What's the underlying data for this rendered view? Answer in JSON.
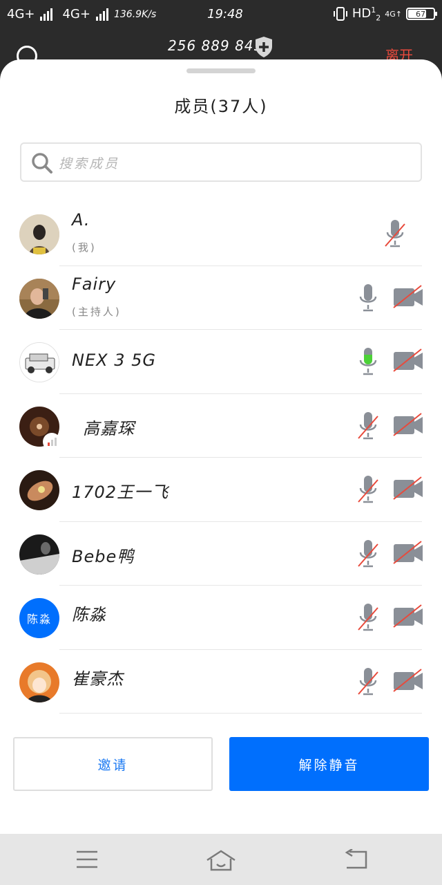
{
  "status_bar": {
    "network1": "4G+",
    "network2": "4G+",
    "speed": "136.9K/s",
    "time": "19:48",
    "hd": "HD",
    "hd_sup": "1",
    "hd_sub": "2",
    "lte": "4G↑",
    "battery": "67"
  },
  "meeting": {
    "id": "256 889 845",
    "leave_label": "离开"
  },
  "sheet": {
    "title": "成员(37人)",
    "search_placeholder": "搜索成员"
  },
  "members": [
    {
      "name": "A.",
      "role": "(我)",
      "mic": "muted",
      "camera": null,
      "avatar": "photo-portrait"
    },
    {
      "name": "Fairy",
      "role": "(主持人)",
      "mic": "idle",
      "camera": "off",
      "avatar": "photo-selfie"
    },
    {
      "name": "NEX 3 5G",
      "role": "",
      "mic": "speaking",
      "camera": "off",
      "avatar": "photo-car"
    },
    {
      "name": "高嘉琛",
      "role": "",
      "mic": "muted",
      "camera": "off",
      "avatar": "photo-dark",
      "talking_badge": true
    },
    {
      "name": "1702王一飞",
      "role": "",
      "mic": "muted",
      "camera": "off",
      "avatar": "photo-hand"
    },
    {
      "name": "Bebe鸭",
      "role": "",
      "mic": "muted",
      "camera": "off",
      "avatar": "photo-bw"
    },
    {
      "name": "陈淼",
      "role": "",
      "mic": "muted",
      "camera": "off",
      "avatar": "text",
      "avatar_text": "陈淼"
    },
    {
      "name": "崔豪杰",
      "role": "",
      "mic": "muted",
      "camera": "off",
      "avatar": "photo-anime"
    }
  ],
  "buttons": {
    "invite": "邀请",
    "unmute_all": "解除静音"
  },
  "colors": {
    "accent": "#006ffd",
    "leave": "#e84a3c",
    "speaking": "#4cd137",
    "muted_slash": "#e84a3c",
    "icon_gray": "#8a8f97"
  }
}
